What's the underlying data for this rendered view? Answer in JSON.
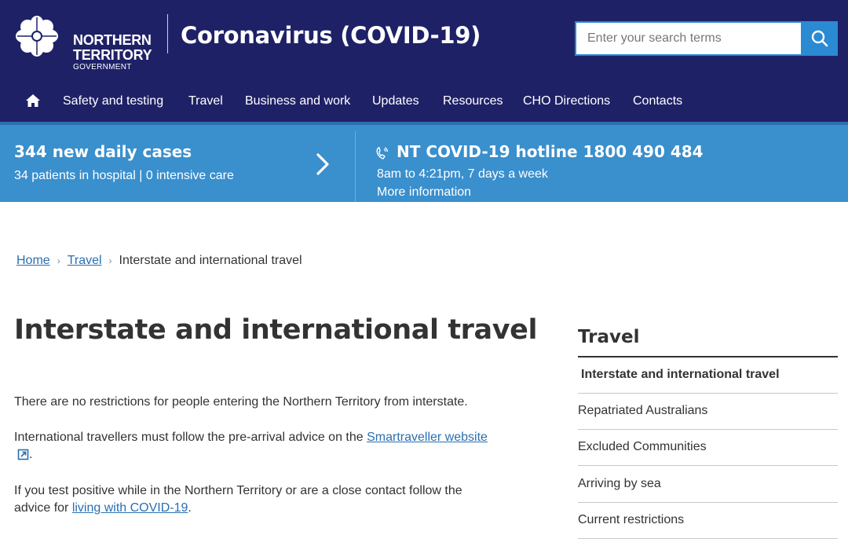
{
  "header": {
    "logo": {
      "line1": "NORTHERN",
      "line2": "TERRITORY",
      "line3": "GOVERNMENT"
    },
    "site_title": "Coronavirus (COVID-19)",
    "search": {
      "placeholder": "Enter your search terms",
      "icon": "search-icon"
    }
  },
  "nav": {
    "home_icon": "home-icon",
    "items": [
      {
        "label": "Safety and testing"
      },
      {
        "label": "Travel"
      },
      {
        "label": "Business and work"
      },
      {
        "label": "Updates"
      },
      {
        "label": "Resources"
      },
      {
        "label": "CHO Directions"
      },
      {
        "label": "Contacts"
      }
    ]
  },
  "alert_band": {
    "cases_title": "344 new daily cases",
    "cases_sub": "34 patients in hospital | 0 intensive care",
    "hotline": "NT COVID-19 hotline 1800 490 484",
    "hours": "8am to 4:21pm, 7 days a week",
    "more_info": "More information"
  },
  "breadcrumb": {
    "home": "Home",
    "travel": "Travel",
    "current": "Interstate and international travel",
    "separator": "›"
  },
  "main": {
    "title": "Interstate and international travel",
    "p1": "There are no restrictions for people entering the Northern Territory from interstate.",
    "p2_text": "International travellers must follow the pre-arrival advice on the ",
    "p2_link": "Smartraveller website",
    "p2_end": ".",
    "p3_text_a": "If you test positive while in the Northern Territory or are a close contact follow the advice for ",
    "p3_link": "living with COVID-19",
    "p3_end": "."
  },
  "sidebar": {
    "title": "Travel",
    "items": [
      {
        "label": "Interstate and international travel"
      },
      {
        "label": "Repatriated Australians"
      },
      {
        "label": "Excluded Communities"
      },
      {
        "label": "Arriving by sea"
      },
      {
        "label": "Current restrictions"
      }
    ]
  },
  "colors": {
    "header_bg": "#1f2167",
    "band_bg": "#3a8fcd",
    "accent": "#2a8ad2",
    "link": "#2a6fb0"
  }
}
